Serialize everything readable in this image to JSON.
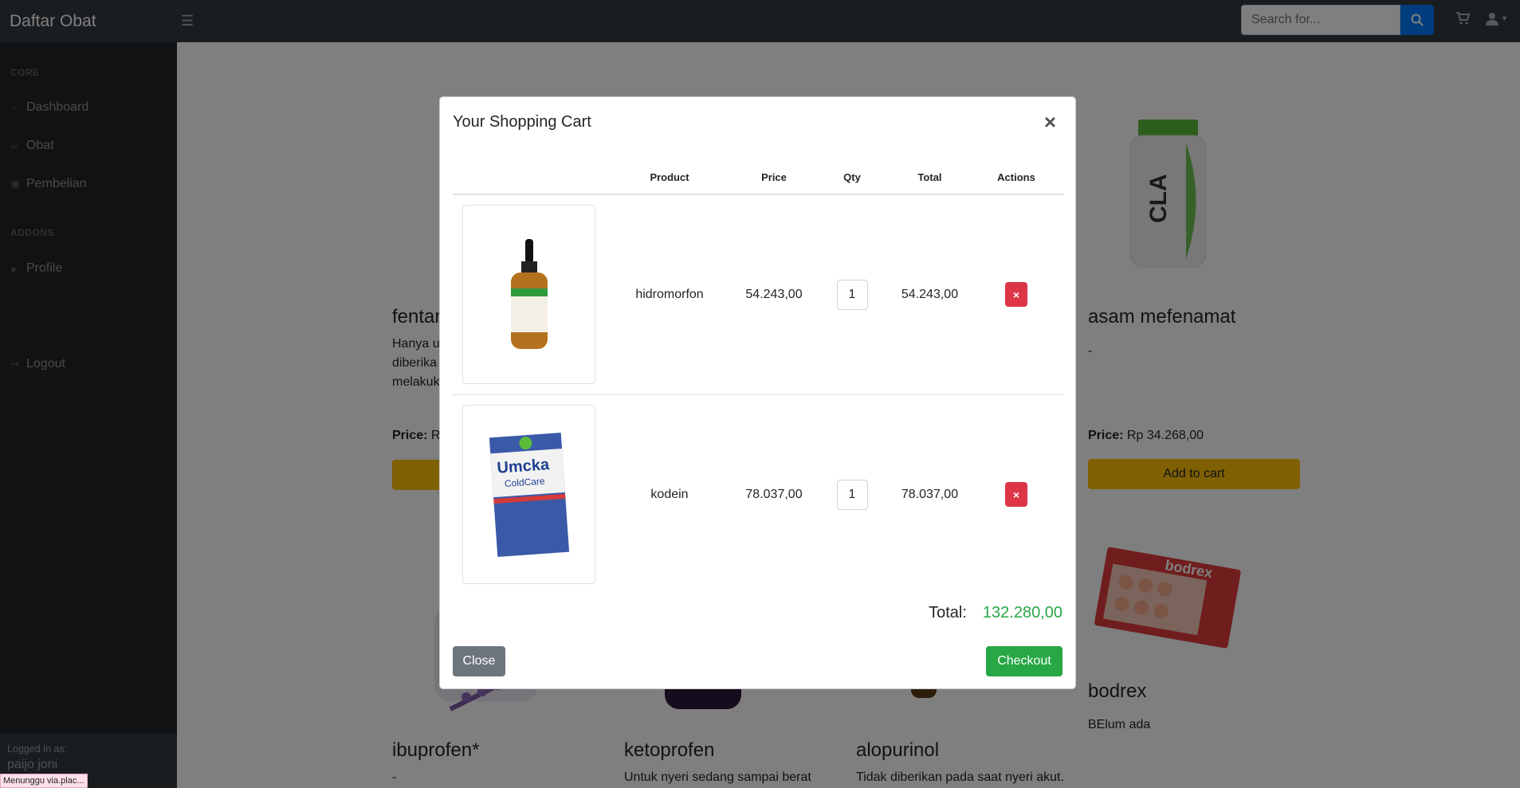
{
  "navbar": {
    "brand": "Daftar Obat",
    "search_placeholder": "Search for...",
    "icons": [
      "menu-icon",
      "search-icon",
      "cart-icon",
      "user-icon"
    ]
  },
  "sidebar": {
    "sections": [
      {
        "heading": "CORE",
        "items": [
          {
            "label": "Dashboard",
            "icon": "dashboard-icon"
          },
          {
            "label": "Obat",
            "icon": "pills-icon"
          },
          {
            "label": "Pembelian",
            "icon": "bag-icon"
          }
        ]
      },
      {
        "heading": "ADDONS",
        "items": [
          {
            "label": "Profile",
            "icon": "user-icon"
          }
        ]
      }
    ],
    "logout": "Logout",
    "footer_small": "Logged in as:",
    "footer_user": "paijo joni"
  },
  "status_tooltip": "Menunggu via.plac...",
  "products": [
    {
      "name": "fentar",
      "desc": [
        "Hanya u",
        "diberika",
        "melakuk"
      ],
      "price_label": "Price:",
      "price": "R"
    },
    {
      "name": "asam mefenamat",
      "desc": [
        "-"
      ],
      "price_label": "Price:",
      "price": "Rp 34.268,00",
      "button": "Add to cart"
    },
    {
      "name": "ibuprofen*",
      "desc": [
        "-"
      ]
    },
    {
      "name": "ketoprofen",
      "desc": [
        "Untuk nyeri sedang sampai berat"
      ]
    },
    {
      "name": "alopurinol",
      "desc": [
        "Tidak diberikan pada saat nyeri akut."
      ]
    },
    {
      "name": "bodrex",
      "desc": [
        "BElum ada"
      ]
    }
  ],
  "modal": {
    "title": "Your Shopping Cart",
    "close_symbol": "×",
    "columns": [
      "",
      "Product",
      "Price",
      "Qty",
      "Total",
      "Actions"
    ],
    "rows": [
      {
        "product": "hidromorfon",
        "price": "54.243,00",
        "qty": "1",
        "total": "54.243,00",
        "action": "×"
      },
      {
        "product": "kodein",
        "price": "78.037,00",
        "qty": "1",
        "total": "78.037,00",
        "action": "×"
      }
    ],
    "total_label": "Total:",
    "total_value": "132.280,00",
    "close_button": "Close",
    "checkout_button": "Checkout"
  },
  "colors": {
    "navbar": "#343a40",
    "sidebar": "#212529",
    "primary": "#007bff",
    "warning": "#ffc107",
    "danger": "#dc3545",
    "success": "#28a745",
    "secondary": "#6c757d"
  }
}
